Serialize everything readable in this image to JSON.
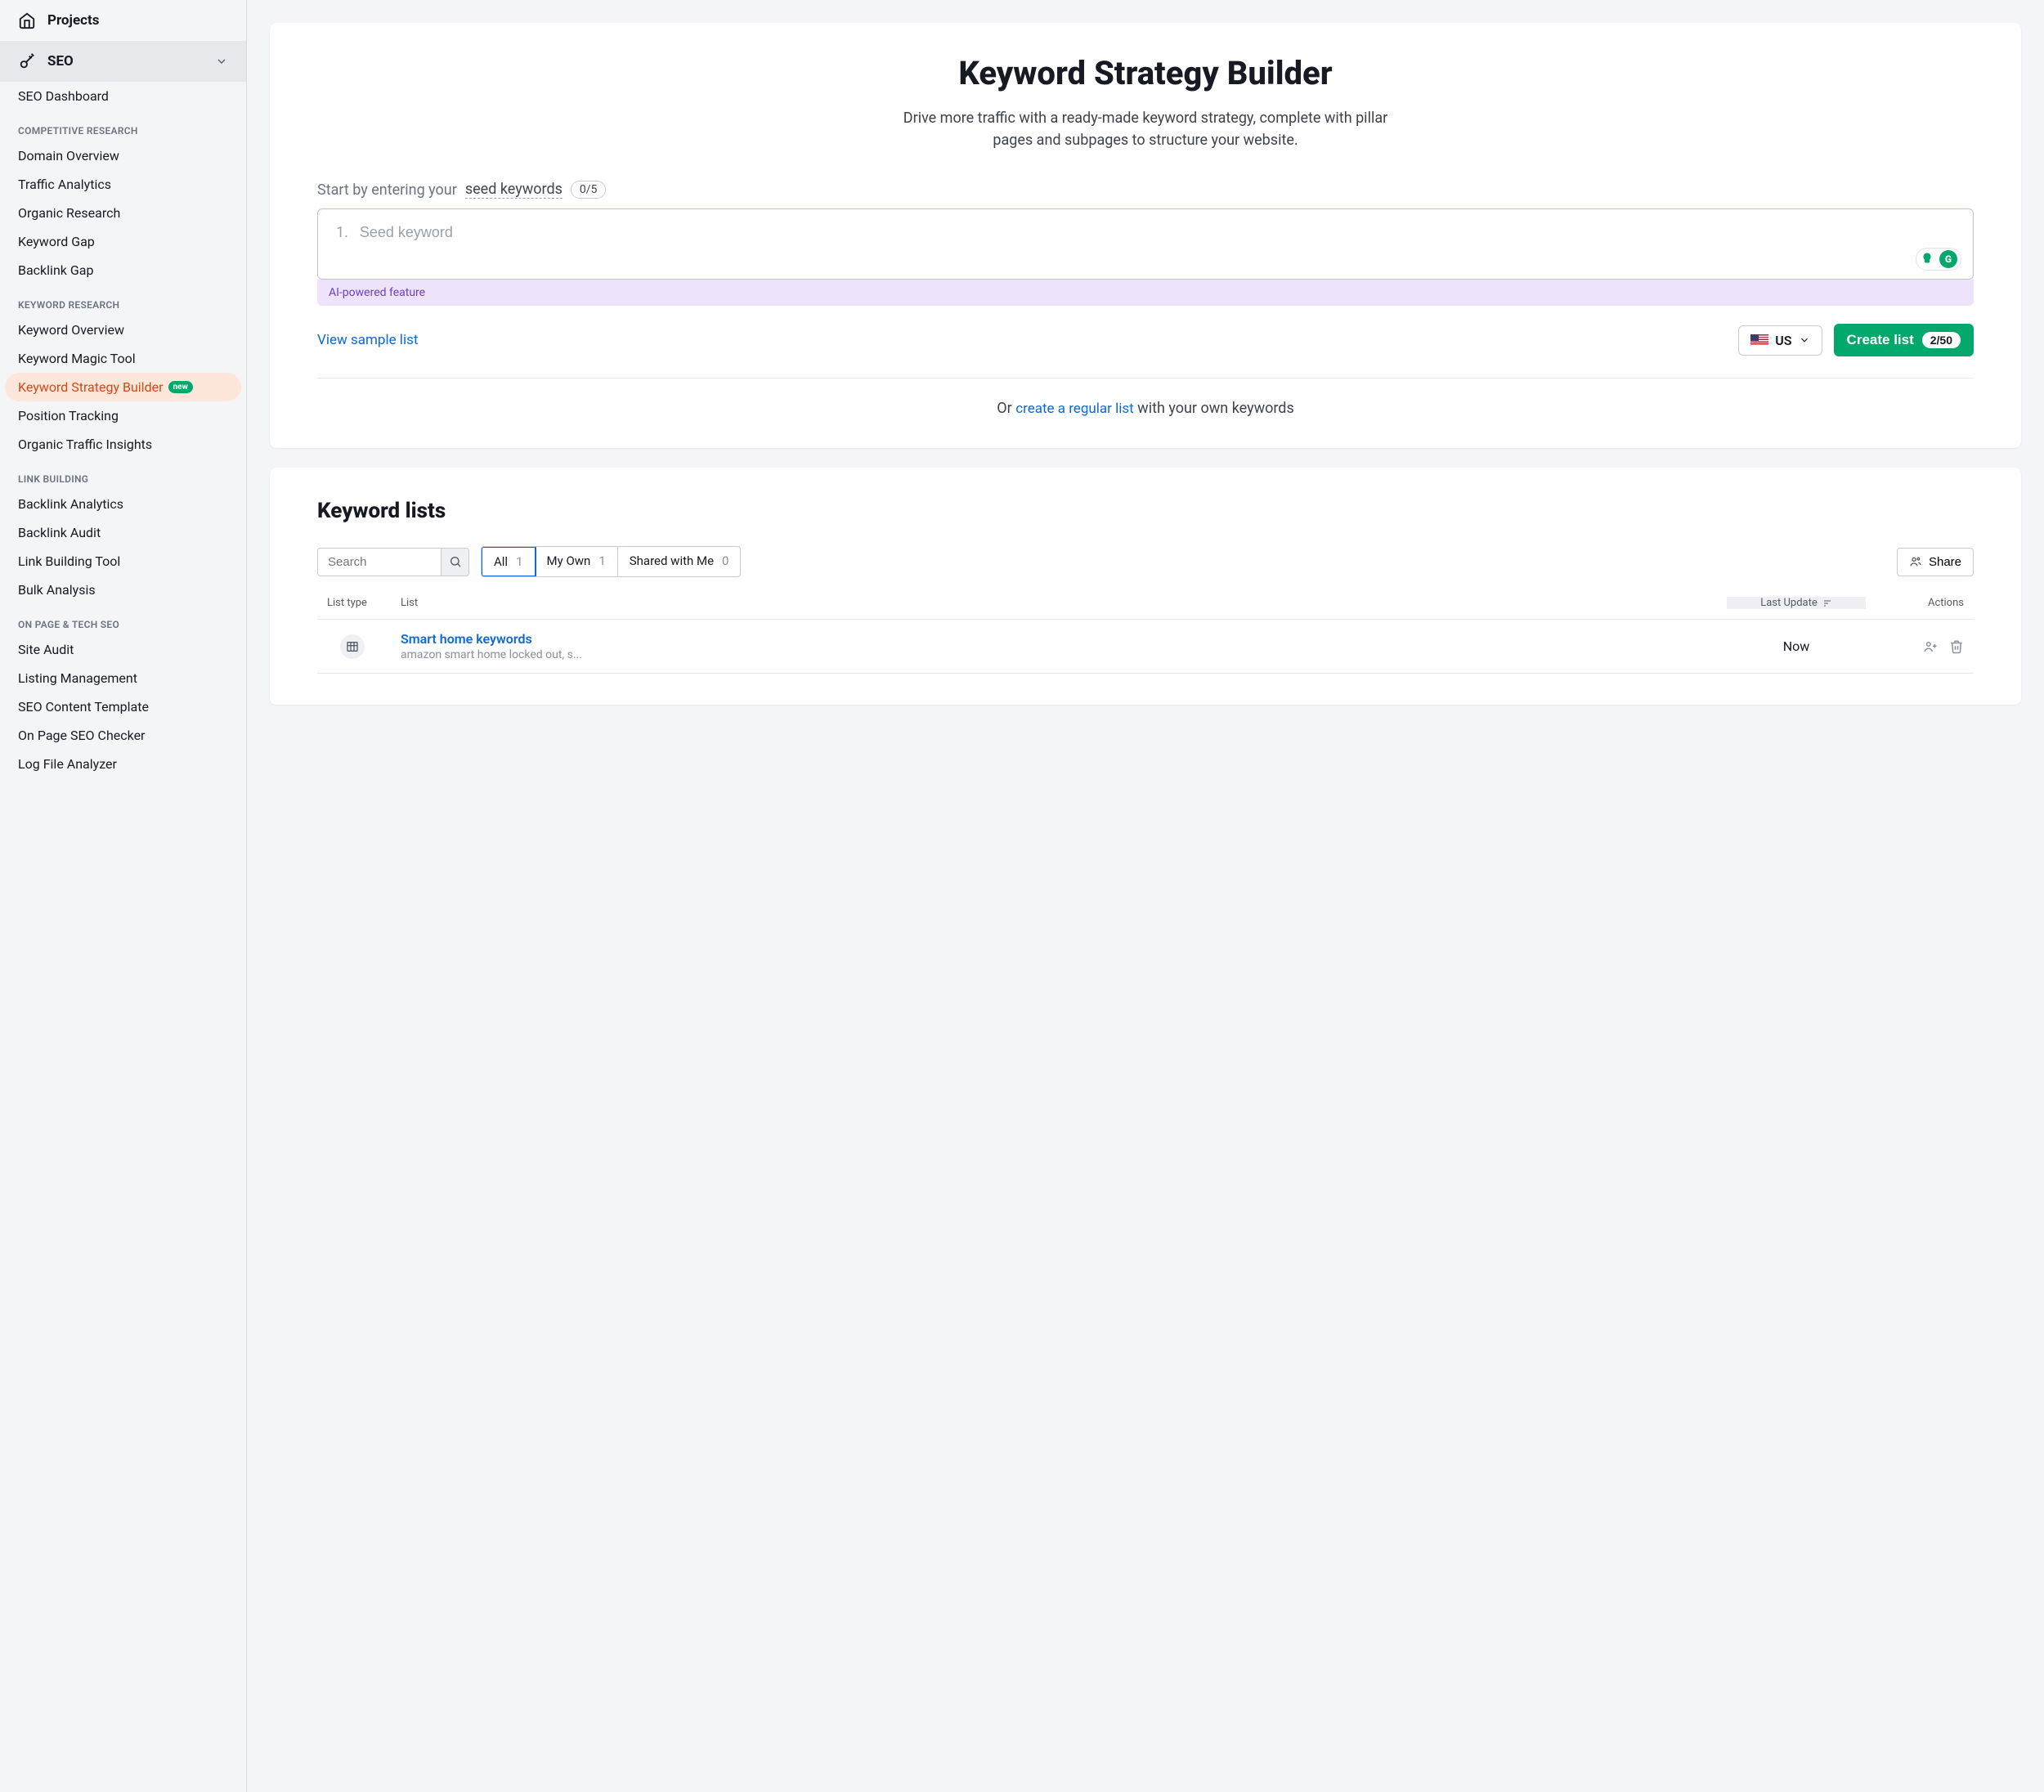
{
  "sidebar": {
    "top": {
      "label": "Projects"
    },
    "section": {
      "label": "SEO"
    },
    "dashboard": "SEO Dashboard",
    "cats": {
      "competitive": "COMPETITIVE RESEARCH",
      "keyword": "KEYWORD RESEARCH",
      "link": "LINK BUILDING",
      "onpage": "ON PAGE & TECH SEO"
    },
    "items": {
      "domain_overview": "Domain Overview",
      "traffic_analytics": "Traffic Analytics",
      "organic_research": "Organic Research",
      "keyword_gap": "Keyword Gap",
      "backlink_gap": "Backlink Gap",
      "keyword_overview": "Keyword Overview",
      "keyword_magic": "Keyword Magic Tool",
      "keyword_strategy": "Keyword Strategy Builder",
      "ksb_badge": "new",
      "position_tracking": "Position Tracking",
      "organic_traffic": "Organic Traffic Insights",
      "backlink_analytics": "Backlink Analytics",
      "backlink_audit": "Backlink Audit",
      "link_building": "Link Building Tool",
      "bulk_analysis": "Bulk Analysis",
      "site_audit": "Site Audit",
      "listing_mgmt": "Listing Management",
      "seo_content": "SEO Content Template",
      "onpage_checker": "On Page SEO Checker",
      "log_file": "Log File Analyzer"
    }
  },
  "builder": {
    "title": "Keyword Strategy Builder",
    "subtitle": "Drive more traffic with a ready-made keyword strategy, complete with pillar pages and subpages to structure your website.",
    "seed_label_pre": "Start by entering your ",
    "seed_label_kw": "seed keywords",
    "seed_count": "0/5",
    "seed_num": "1.",
    "seed_placeholder": "Seed keyword",
    "ai_note": "AI-powered feature",
    "view_sample": "View sample list",
    "country_code": "US",
    "create_label": "Create list",
    "create_count": "2/50",
    "or_pre": "Or ",
    "or_link": "create a regular list",
    "or_post": " with your own keywords"
  },
  "lists": {
    "title": "Keyword lists",
    "search_placeholder": "Search",
    "tabs": {
      "all": {
        "label": "All",
        "count": "1"
      },
      "own": {
        "label": "My Own",
        "count": "1"
      },
      "shared": {
        "label": "Shared with Me",
        "count": "0"
      }
    },
    "share_label": "Share",
    "cols": {
      "type": "List type",
      "list": "List",
      "last": "Last Update",
      "actions": "Actions"
    },
    "rows": [
      {
        "name": "Smart home keywords",
        "sub": "amazon smart home locked out, s...",
        "last": "Now"
      }
    ]
  }
}
